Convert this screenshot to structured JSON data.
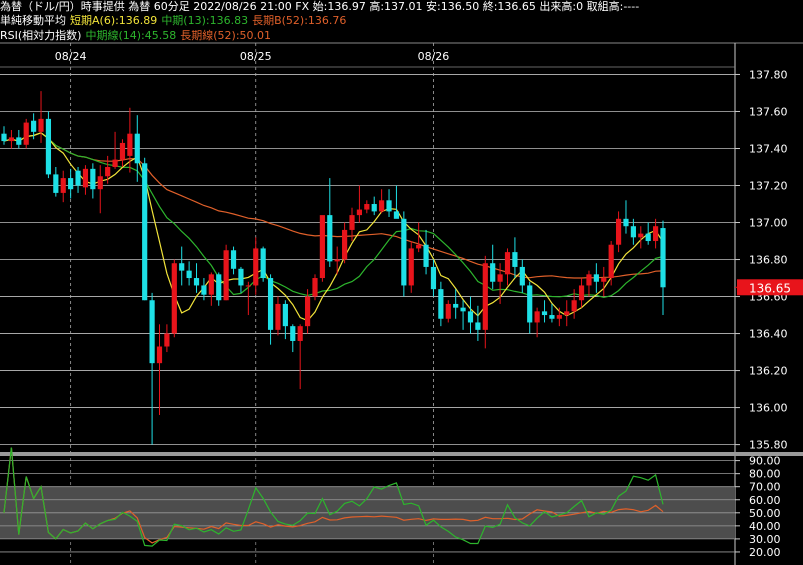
{
  "header": {
    "line1": "為替（ドル/円）時事提供 為替 60分足 2022/08/26 21:00 FX 始:136.97 高:137.01 安:136.50 終:136.65 出来高:0 取組高:----",
    "ma_title": "単純移動平均",
    "ma_short": "短期A(6):136.89",
    "ma_mid": "中期(13):136.83",
    "ma_long": "長期B(52):136.76",
    "rsi_title": "RSI(相対力指数)",
    "rsi_mid": "中期線(14):45.58",
    "rsi_long": "長期線(52):50.01"
  },
  "colors": {
    "up": "#e8141b",
    "down": "#1ee0e6",
    "ma_short": "#f2e43a",
    "ma_mid": "#2db52d",
    "ma_long": "#e0602a",
    "rsi_mid": "#2db52d",
    "rsi_long": "#e0602a",
    "price_label_bg": "#e8141b"
  },
  "current_price_label": "136.65",
  "chart_data": [
    {
      "type": "candlestick",
      "title": "為替（ドル/円） 60分足",
      "date_labels": [
        {
          "label": "08/24",
          "index": 9
        },
        {
          "label": "08/25",
          "index": 34
        },
        {
          "label": "08/26",
          "index": 58
        }
      ],
      "yticks": [
        "137.80",
        "137.60",
        "137.40",
        "137.20",
        "137.00",
        "136.80",
        "136.60",
        "136.40",
        "136.20",
        "136.00",
        "135.80"
      ],
      "ylim": [
        135.76,
        137.97
      ],
      "current_price": 136.65,
      "ohlc": [
        [
          137.48,
          137.52,
          137.42,
          137.44
        ],
        [
          137.44,
          137.5,
          137.4,
          137.46
        ],
        [
          137.46,
          137.5,
          137.4,
          137.42
        ],
        [
          137.42,
          137.56,
          137.4,
          137.54
        ],
        [
          137.55,
          137.59,
          137.45,
          137.49
        ],
        [
          137.49,
          137.71,
          137.43,
          137.56
        ],
        [
          137.56,
          137.6,
          137.24,
          137.26
        ],
        [
          137.26,
          137.3,
          137.14,
          137.16
        ],
        [
          137.16,
          137.28,
          137.11,
          137.24
        ],
        [
          137.24,
          137.29,
          137.13,
          137.18
        ],
        [
          137.28,
          137.3,
          137.16,
          137.2
        ],
        [
          137.19,
          137.31,
          137.15,
          137.29
        ],
        [
          137.29,
          137.32,
          137.13,
          137.18
        ],
        [
          137.18,
          137.31,
          137.05,
          137.25
        ],
        [
          137.25,
          137.36,
          137.21,
          137.3
        ],
        [
          137.3,
          137.49,
          137.29,
          137.34
        ],
        [
          137.34,
          137.45,
          137.3,
          137.43
        ],
        [
          137.36,
          137.62,
          137.27,
          137.48
        ],
        [
          137.48,
          137.58,
          137.22,
          137.32
        ],
        [
          137.32,
          137.35,
          136.58,
          136.58
        ],
        [
          136.58,
          136.62,
          135.8,
          136.24
        ],
        [
          136.24,
          136.45,
          135.96,
          136.33
        ],
        [
          136.33,
          136.45,
          136.3,
          136.4
        ],
        [
          136.4,
          136.8,
          136.38,
          136.78
        ],
        [
          136.78,
          136.87,
          136.66,
          136.74
        ],
        [
          136.74,
          136.79,
          136.66,
          136.7
        ],
        [
          136.7,
          136.78,
          136.62,
          136.66
        ],
        [
          136.66,
          136.7,
          136.58,
          136.61
        ],
        [
          136.61,
          136.73,
          136.55,
          136.72
        ],
        [
          136.72,
          136.73,
          136.55,
          136.58
        ],
        [
          136.58,
          136.88,
          136.58,
          136.85
        ],
        [
          136.85,
          136.87,
          136.72,
          136.75
        ],
        [
          136.75,
          136.76,
          136.62,
          136.66
        ],
        [
          136.66,
          136.68,
          136.5,
          136.66
        ],
        [
          136.66,
          136.92,
          136.61,
          136.86
        ],
        [
          136.86,
          136.87,
          136.68,
          136.7
        ],
        [
          136.7,
          136.72,
          136.34,
          136.42
        ],
        [
          136.42,
          136.6,
          136.39,
          136.56
        ],
        [
          136.56,
          136.58,
          136.37,
          136.44
        ],
        [
          136.44,
          136.45,
          136.3,
          136.36
        ],
        [
          136.36,
          136.45,
          136.1,
          136.44
        ],
        [
          136.44,
          136.64,
          136.4,
          136.6
        ],
        [
          136.6,
          136.72,
          136.58,
          136.7
        ],
        [
          136.7,
          136.91,
          136.68,
          137.04
        ],
        [
          137.04,
          137.24,
          136.76,
          136.79
        ],
        [
          136.79,
          136.87,
          136.72,
          136.8
        ],
        [
          136.8,
          137.0,
          136.78,
          136.96
        ],
        [
          136.96,
          137.08,
          136.9,
          137.04
        ],
        [
          137.04,
          137.2,
          137.0,
          137.07
        ],
        [
          137.07,
          137.12,
          137.05,
          137.1
        ],
        [
          137.1,
          137.14,
          137.04,
          137.06
        ],
        [
          137.06,
          137.18,
          137.05,
          137.12
        ],
        [
          137.12,
          137.18,
          137.03,
          137.06
        ],
        [
          137.06,
          137.2,
          137.04,
          137.02
        ],
        [
          137.02,
          137.06,
          136.6,
          136.66
        ],
        [
          136.66,
          136.9,
          136.62,
          136.86
        ],
        [
          136.86,
          137.0,
          136.84,
          136.88
        ],
        [
          136.88,
          136.96,
          136.72,
          136.76
        ],
        [
          136.76,
          136.8,
          136.6,
          136.64
        ],
        [
          136.64,
          136.68,
          136.44,
          136.48
        ],
        [
          136.48,
          136.58,
          136.46,
          136.56
        ],
        [
          136.56,
          136.64,
          136.48,
          136.54
        ],
        [
          136.54,
          136.58,
          136.42,
          136.52
        ],
        [
          136.52,
          136.6,
          136.4,
          136.46
        ],
        [
          136.46,
          136.55,
          136.36,
          136.42
        ],
        [
          136.42,
          136.82,
          136.32,
          136.78
        ],
        [
          136.78,
          136.88,
          136.64,
          136.68
        ],
        [
          136.68,
          136.78,
          136.56,
          136.72
        ],
        [
          136.72,
          136.86,
          136.66,
          136.84
        ],
        [
          136.84,
          136.92,
          136.7,
          136.76
        ],
        [
          136.76,
          136.8,
          136.62,
          136.66
        ],
        [
          136.66,
          136.68,
          136.4,
          136.46
        ],
        [
          136.46,
          136.54,
          136.38,
          136.52
        ],
        [
          136.52,
          136.58,
          136.46,
          136.5
        ],
        [
          136.5,
          136.56,
          136.46,
          136.48
        ],
        [
          136.48,
          136.54,
          136.44,
          136.5
        ],
        [
          136.5,
          136.58,
          136.44,
          136.52
        ],
        [
          136.52,
          136.64,
          136.48,
          136.58
        ],
        [
          136.58,
          136.7,
          136.54,
          136.66
        ],
        [
          136.66,
          136.74,
          136.6,
          136.72
        ],
        [
          136.72,
          136.78,
          136.62,
          136.68
        ],
        [
          136.68,
          136.76,
          136.6,
          136.7
        ],
        [
          136.7,
          136.9,
          136.66,
          136.88
        ],
        [
          136.88,
          137.06,
          136.84,
          137.02
        ],
        [
          137.02,
          137.12,
          136.94,
          136.98
        ],
        [
          136.98,
          137.02,
          136.88,
          136.92
        ],
        [
          136.92,
          136.98,
          136.86,
          136.94
        ],
        [
          136.94,
          137.0,
          136.88,
          136.9
        ],
        [
          136.9,
          137.02,
          136.86,
          136.98
        ],
        [
          136.97,
          137.01,
          136.5,
          136.65
        ]
      ]
    },
    {
      "type": "line",
      "title": "RSI(相対力指数)",
      "yticks": [
        "90.00",
        "80.00",
        "70.00",
        "60.00",
        "50.00",
        "40.00",
        "30.00",
        "20.00"
      ],
      "ylim": [
        10,
        92
      ],
      "bands": [
        [
          30,
          70
        ]
      ]
    }
  ]
}
